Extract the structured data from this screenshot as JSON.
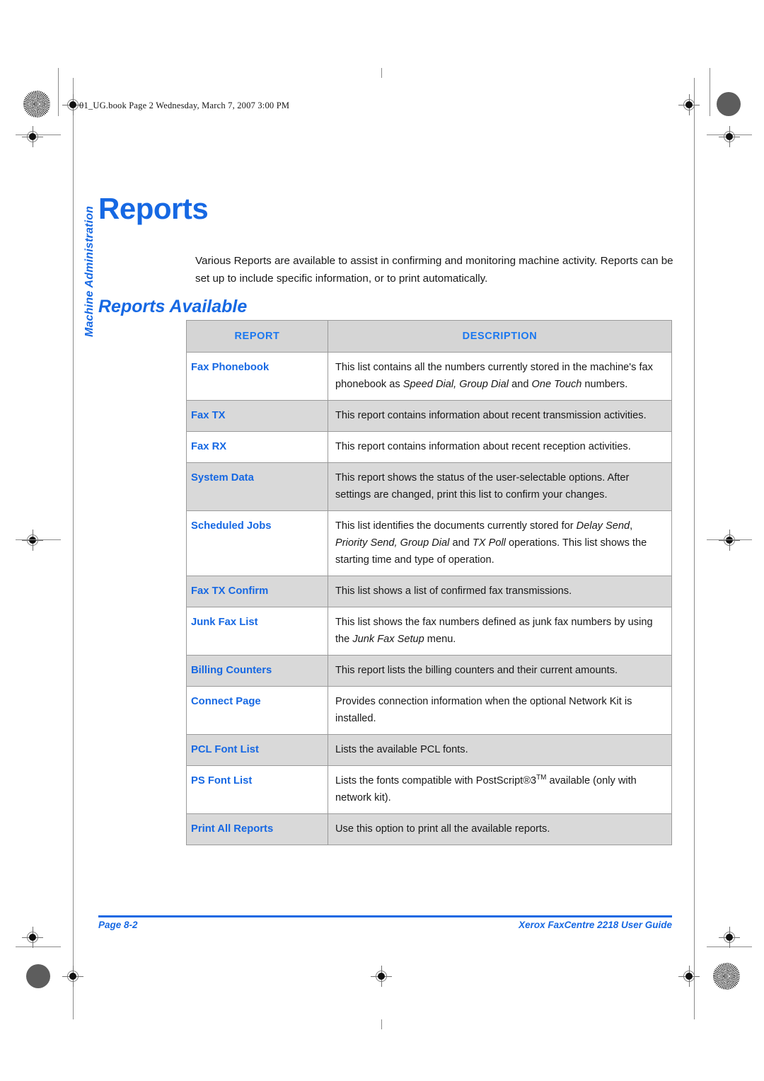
{
  "file_header": "01_UG.book  Page 2  Wednesday, March 7, 2007  3:00 PM",
  "side_tab": "Machine Administration",
  "chapter_title": "Reports",
  "intro_text": "Various Reports are available to assist in confirming and monitoring machine activity. Reports can be set up to include specific information, or to print automatically.",
  "section_title": "Reports Available",
  "table": {
    "columns": [
      "REPORT",
      "DESCRIPTION"
    ],
    "rows": [
      {
        "name": "Fax Phonebook",
        "description": "This list contains all the numbers currently stored in the machine's fax phonebook as Speed Dial, Group Dial and One Touch numbers.",
        "shaded": false
      },
      {
        "name": "Fax TX",
        "description": "This report contains information about recent transmission activities.",
        "shaded": true
      },
      {
        "name": "Fax RX",
        "description": "This report contains information about recent reception activities.",
        "shaded": false
      },
      {
        "name": "System Data",
        "description": "This report shows the status of the user-selectable options. After settings are changed, print this list to confirm your changes.",
        "shaded": true
      },
      {
        "name": "Scheduled Jobs",
        "description": "This list identifies the documents currently stored for Delay Send, Priority Send, Group Dial and TX Poll operations. This list shows the starting time and type of operation.",
        "shaded": false
      },
      {
        "name": "Fax TX Confirm",
        "description": "This list shows a list of confirmed fax transmissions.",
        "shaded": true
      },
      {
        "name": "Junk Fax List",
        "description": "This list shows the fax numbers defined as junk fax numbers by using the Junk Fax Setup menu.",
        "shaded": false
      },
      {
        "name": "Billing Counters",
        "description": "This report lists the billing counters and their current amounts.",
        "shaded": true
      },
      {
        "name": "Connect Page",
        "description": "Provides connection information when the optional Network Kit is installed.",
        "shaded": false
      },
      {
        "name": "PCL Font List",
        "description": "Lists the available PCL fonts.",
        "shaded": true
      },
      {
        "name": "PS Font List",
        "description": "Lists the fonts compatible with PostScript®3TM available (only with network kit).",
        "shaded": false
      },
      {
        "name": "Print All Reports",
        "description": "Use this option to print all the available reports.",
        "shaded": true
      }
    ]
  },
  "footer": {
    "left": "Page 8-2",
    "right": "Xerox FaxCentre 2218 User Guide"
  },
  "colors": {
    "accent_blue": "#1668e3",
    "header_blue": "#1b78f0",
    "row_shade": "#d9d9d9",
    "table_header_bg": "#d5d5d5",
    "table_border": "#9a9a9a"
  }
}
